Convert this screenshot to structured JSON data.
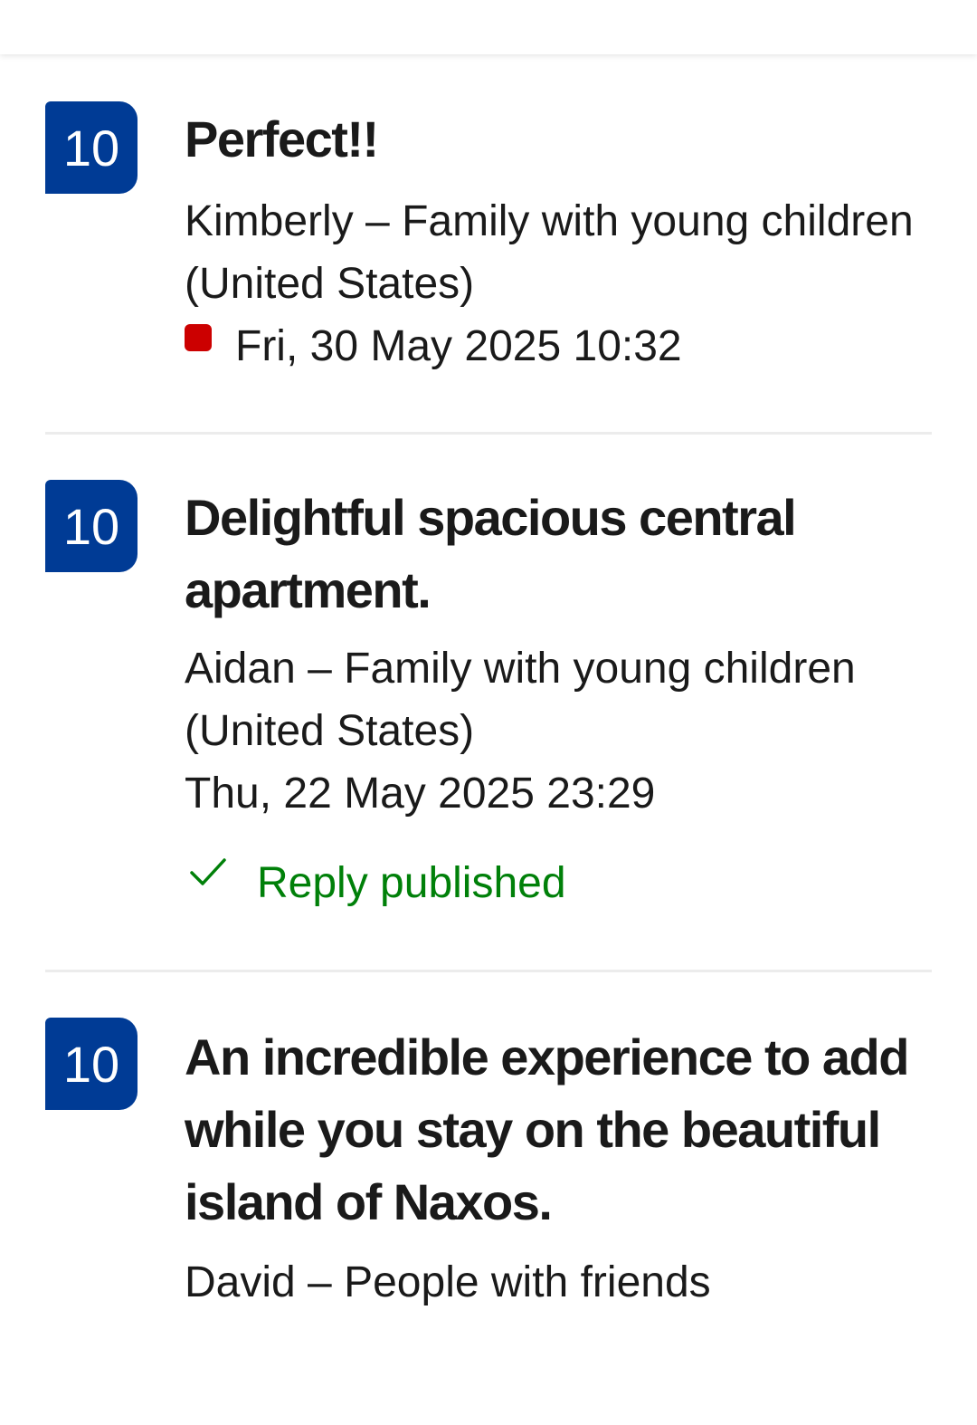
{
  "reviews": [
    {
      "score": "10",
      "title": "Perfect!!",
      "author": "Kimberly – Family with young children (United States)",
      "date": "Fri, 30 May 2025 10:32",
      "is_new": true,
      "new_color": "#cc0000"
    },
    {
      "score": "10",
      "title": "Delightful spacious central apartment.",
      "author": "Aidan – Family with young children (United States)",
      "date": "Thu, 22 May 2025 23:29",
      "reply_status": "Reply published",
      "reply_color": "#008009"
    },
    {
      "score": "10",
      "title": "An incredible experience to add while you stay on the beautiful island of Naxos.",
      "author": "David – People with friends"
    }
  ],
  "colors": {
    "score_badge": "#003b95",
    "divider": "#ececec"
  }
}
